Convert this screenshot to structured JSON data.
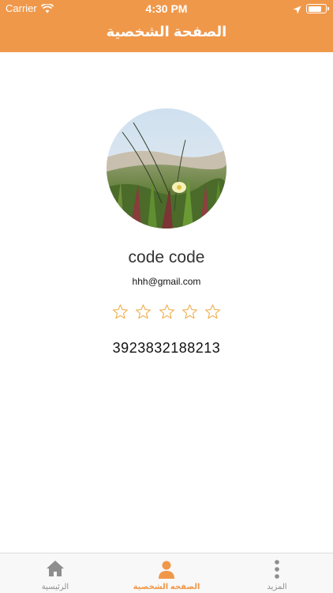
{
  "status_bar": {
    "carrier": "Carrier",
    "time": "4:30 PM"
  },
  "nav": {
    "title": "الصفحة الشخصية"
  },
  "profile": {
    "name": "code code",
    "email": "hhh@gmail.com",
    "rating": 0,
    "rating_max": 5,
    "phone": "3923832188213"
  },
  "tabs": [
    {
      "label": "الرئيسية",
      "icon": "home-icon",
      "active": false
    },
    {
      "label": "الصفحه الشخصية",
      "icon": "person-icon",
      "active": true
    },
    {
      "label": "المزيد",
      "icon": "more-icon",
      "active": false
    }
  ],
  "colors": {
    "accent": "#f0984a",
    "tab_inactive": "#8e8e8e"
  }
}
